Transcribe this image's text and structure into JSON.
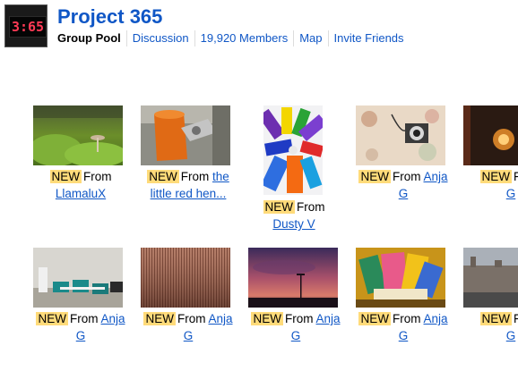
{
  "header": {
    "icon_clock": "3:65",
    "title": "Project 365",
    "nav": [
      "Group Pool",
      "Discussion",
      "19,920 Members",
      "Map",
      "Invite Friends"
    ]
  },
  "new_label": "NEW",
  "from_label": "From",
  "photos": [
    {
      "author_line1": "",
      "author_line2": "LlamaluX"
    },
    {
      "author_line1": "the",
      "author_line2": "little red hen..."
    },
    {
      "author_line1": "",
      "author_line2": "Dusty V"
    },
    {
      "author_line1": "Anja",
      "author_line2": "G"
    },
    {
      "author_line1": "",
      "author_line2": "G"
    },
    {
      "author_line1": "Anja",
      "author_line2": "G"
    },
    {
      "author_line1": "Anja",
      "author_line2": "G"
    },
    {
      "author_line1": "Anja",
      "author_line2": "G"
    },
    {
      "author_line1": "Anja",
      "author_line2": "G"
    },
    {
      "author_line1": "",
      "author_line2": "G"
    }
  ]
}
